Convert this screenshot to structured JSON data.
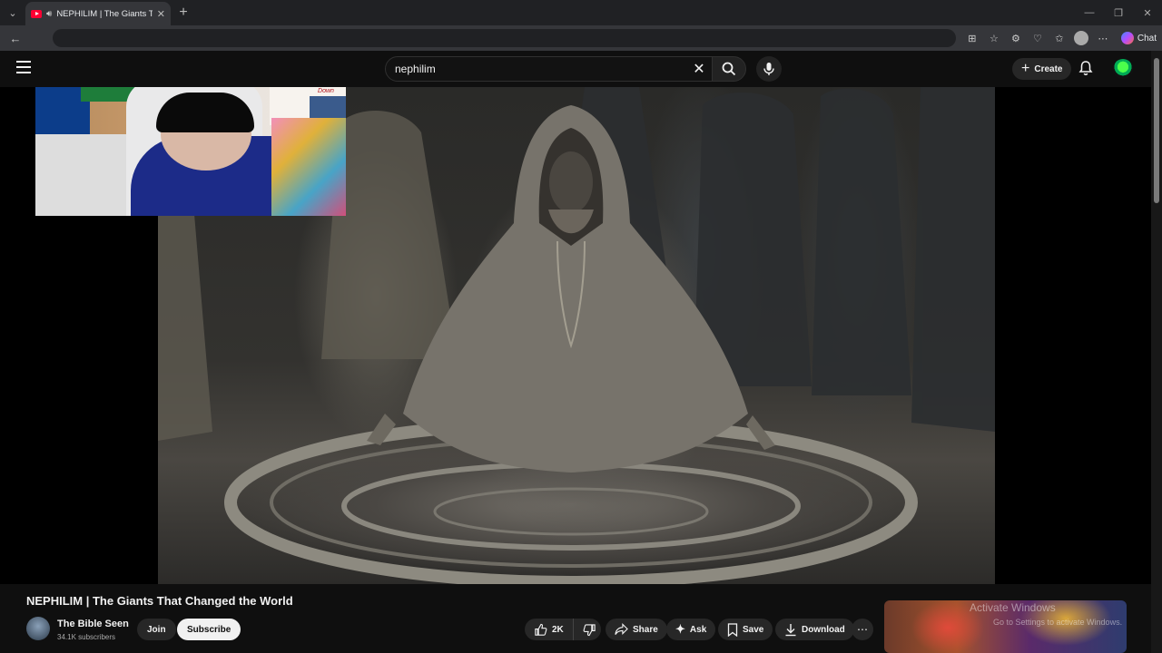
{
  "browser": {
    "tab_title": "NEPHILIM | The Giants That C",
    "chat_label": "Chat"
  },
  "header": {
    "search_value": "nephilim",
    "create_label": "Create"
  },
  "webcam": {
    "sign_text": "Don't Let Life Get Ya Down"
  },
  "video": {
    "title": "NEPHILIM | The Giants That Changed the World",
    "channel_name": "The Bible Seen",
    "subscribers": "34.1K subscribers",
    "join_label": "Join",
    "subscribe_label": "Subscribe",
    "likes": "2K",
    "share_label": "Share",
    "ask_label": "Ask",
    "save_label": "Save",
    "download_label": "Download"
  },
  "overlay": {
    "watermark_title": "Activate Windows",
    "watermark_sub": "Go to Settings to activate Windows."
  },
  "colors": {
    "page_bg": "#0f0f0f",
    "youtube_red": "#ff0033",
    "kick_green": "#53fc18"
  }
}
